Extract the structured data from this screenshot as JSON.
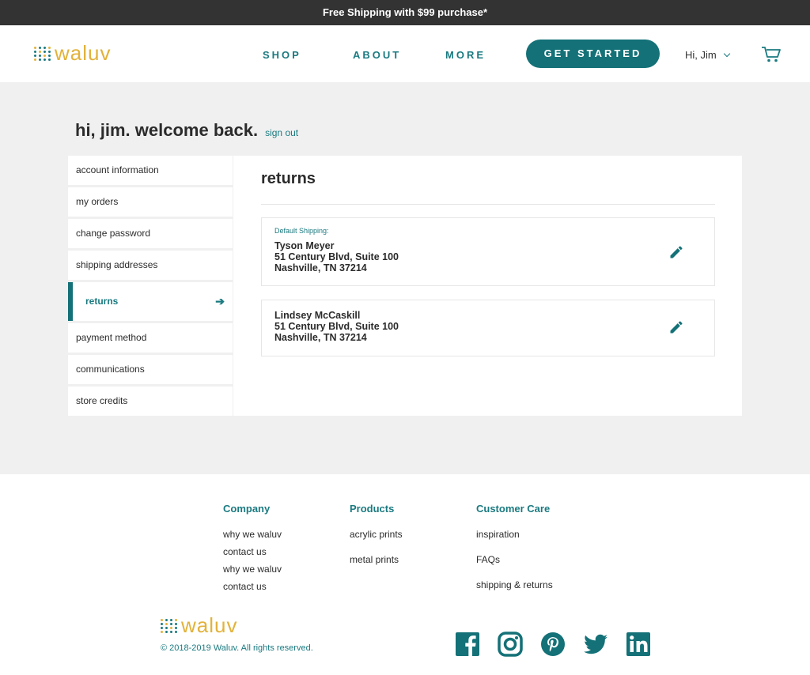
{
  "promo": {
    "text": "Free Shipping with $99 purchase*"
  },
  "brand": {
    "name": "waluv",
    "teal": "#137177",
    "gold": "#e2b23a"
  },
  "nav": {
    "shop": "SHOP",
    "about": "ABOUT",
    "more": "MORE",
    "cta": "GET STARTED",
    "user": "Hi, Jim"
  },
  "welcome": {
    "title": "hi, jim. welcome back.",
    "signout": "sign out"
  },
  "sidebar": {
    "items": [
      {
        "label": "account information"
      },
      {
        "label": "my orders"
      },
      {
        "label": "change password"
      },
      {
        "label": "shipping addresses"
      },
      {
        "label": "returns",
        "active": true
      },
      {
        "label": "payment method"
      },
      {
        "label": "communications"
      },
      {
        "label": "store credits"
      }
    ]
  },
  "panel": {
    "title": "returns",
    "addresses": [
      {
        "label": "Default Shipping:",
        "name": "Tyson Meyer",
        "street": "51 Century Blvd, Suite 100",
        "city": "Nashville, TN 37214"
      },
      {
        "label": "",
        "name": "Lindsey McCaskill",
        "street": "51 Century Blvd, Suite 100",
        "city": "Nashville, TN 37214"
      }
    ]
  },
  "footer": {
    "company": {
      "title": "Company",
      "links": [
        "why we waluv",
        "contact us",
        "why we waluv",
        "contact us"
      ]
    },
    "products": {
      "title": "Products",
      "links": [
        "acrylic prints",
        "metal prints"
      ]
    },
    "care": {
      "title": "Customer Care",
      "links": [
        "inspiration",
        "FAQs",
        "shipping & returns"
      ]
    },
    "copyright": "© 2018-2019 Waluv. All rights reserved."
  },
  "icons": {
    "cart": "cart-icon",
    "edit": "pencil-icon",
    "arrow": "arrow-right-icon",
    "social": [
      "facebook-icon",
      "instagram-icon",
      "pinterest-icon",
      "twitter-icon",
      "linkedin-icon"
    ]
  }
}
